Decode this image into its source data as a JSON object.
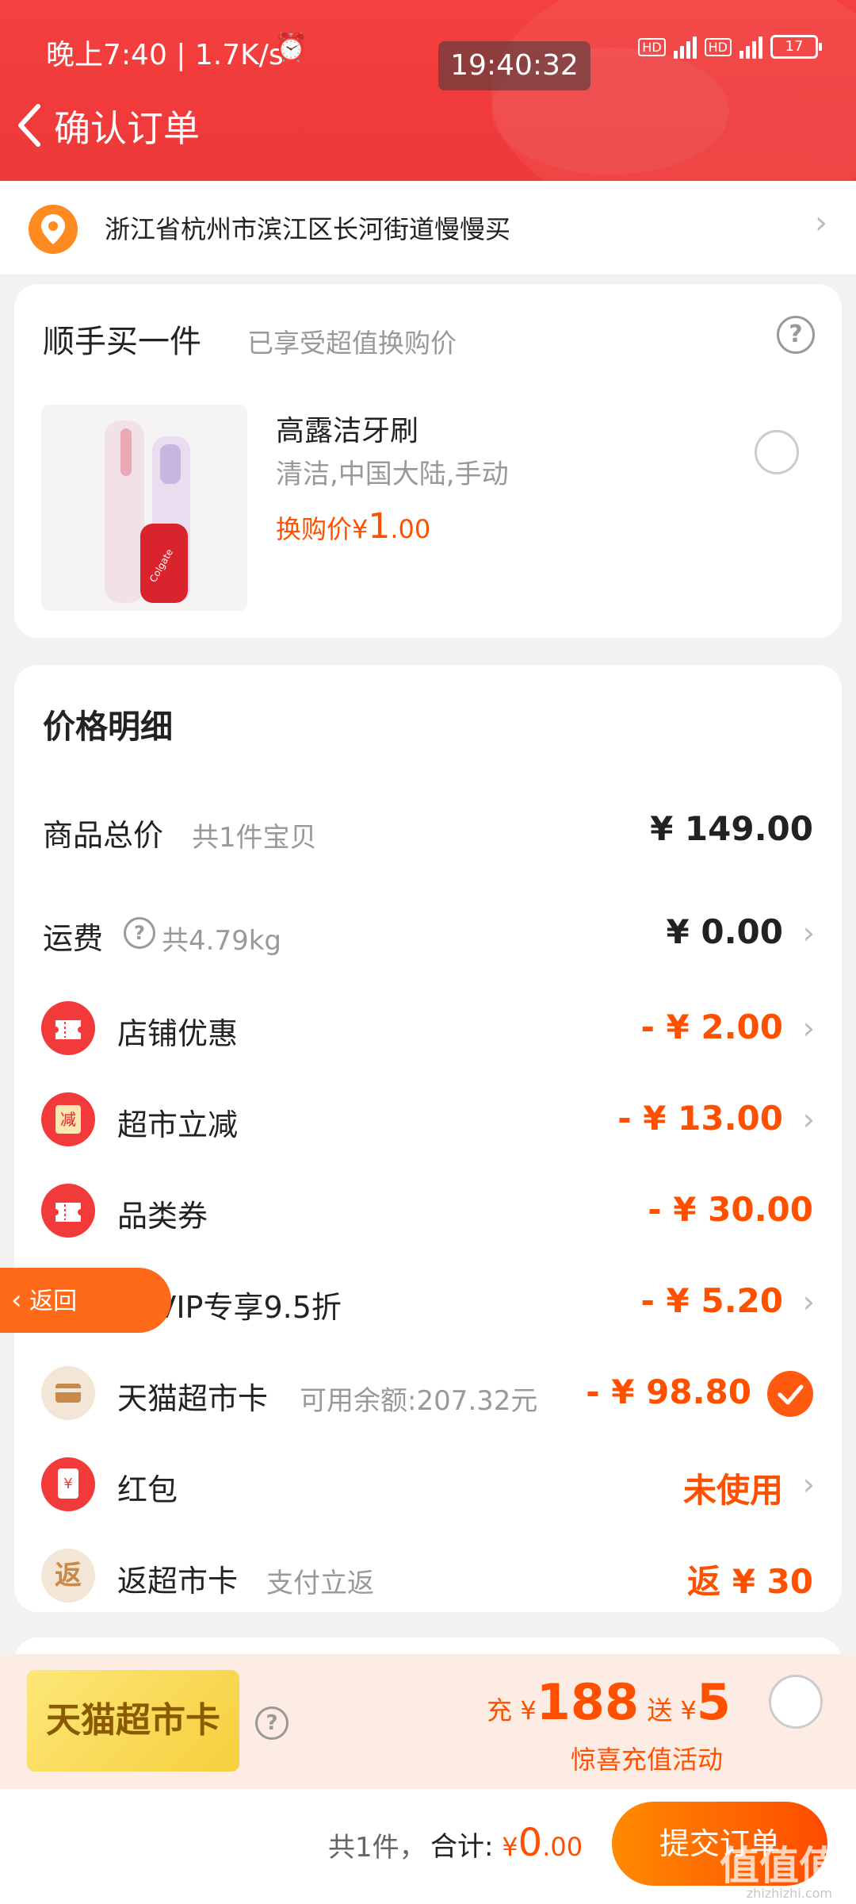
{
  "status_bar": {
    "left": "晚上7:40 | 1.7K/s",
    "clock": "19:40:32",
    "battery": "17"
  },
  "header": {
    "title": "确认订单"
  },
  "address": {
    "text": "浙江省杭州市滨江区长河街道慢慢买"
  },
  "addon": {
    "title": "顺手买一件",
    "subtitle": "已享受超值换购价",
    "product": {
      "name": "高露洁牙刷",
      "spec": "清洁,中国大陆,手动",
      "price_label": "换购价",
      "currency": "¥",
      "price_int": "1",
      "price_dec": ".00",
      "selected": false
    }
  },
  "price_detail": {
    "title": "价格明细",
    "rows": [
      {
        "label": "商品总价",
        "note": "共1件宝贝",
        "value": "¥ 149.00"
      },
      {
        "label": "运费",
        "note": "共4.79kg",
        "value": "¥ 0.00"
      },
      {
        "label": "店铺优惠",
        "value": "- ¥ 2.00",
        "icon": "coupon-icon"
      },
      {
        "label": "超市立减",
        "value": "- ¥ 13.00",
        "icon": "discount-icon",
        "icon_text": "减"
      },
      {
        "label": "品类券",
        "value": "- ¥ 30.00",
        "icon": "coupon-icon"
      },
      {
        "label": "88VIP专享9.5折",
        "value": "- ¥ 5.20",
        "icon": "vip-icon",
        "icon_text": "88"
      },
      {
        "label": "天猫超市卡",
        "note": "可用余额:207.32元",
        "value": "- ¥ 98.80",
        "icon": "card-icon",
        "checked": true
      },
      {
        "label": "红包",
        "value": "未使用",
        "icon": "red-packet-icon",
        "icon_text": "¥"
      },
      {
        "label": "返超市卡",
        "note": "支付立返",
        "value": "返 ¥ 30",
        "icon": "cashback-icon",
        "icon_text": "返"
      }
    ]
  },
  "floating_back": {
    "label": "返回"
  },
  "promo": {
    "badge": "天猫超市卡",
    "charge_prefix": "充",
    "charge_amount": "188",
    "gift_prefix": "送",
    "gift_amount": "5",
    "currency": "¥",
    "desc": "惊喜充值活动"
  },
  "footer": {
    "count": "共1件，",
    "total_label": "合计:",
    "currency": "¥",
    "total_int": "0",
    "total_dec": ".00",
    "submit": "提交订单"
  },
  "watermark": {
    "text": "值值值",
    "sub": "zhizhizhi.com"
  },
  "colors": {
    "header": "#f03a3b",
    "accent": "#ff5000",
    "vip": "#3a3a3a"
  }
}
